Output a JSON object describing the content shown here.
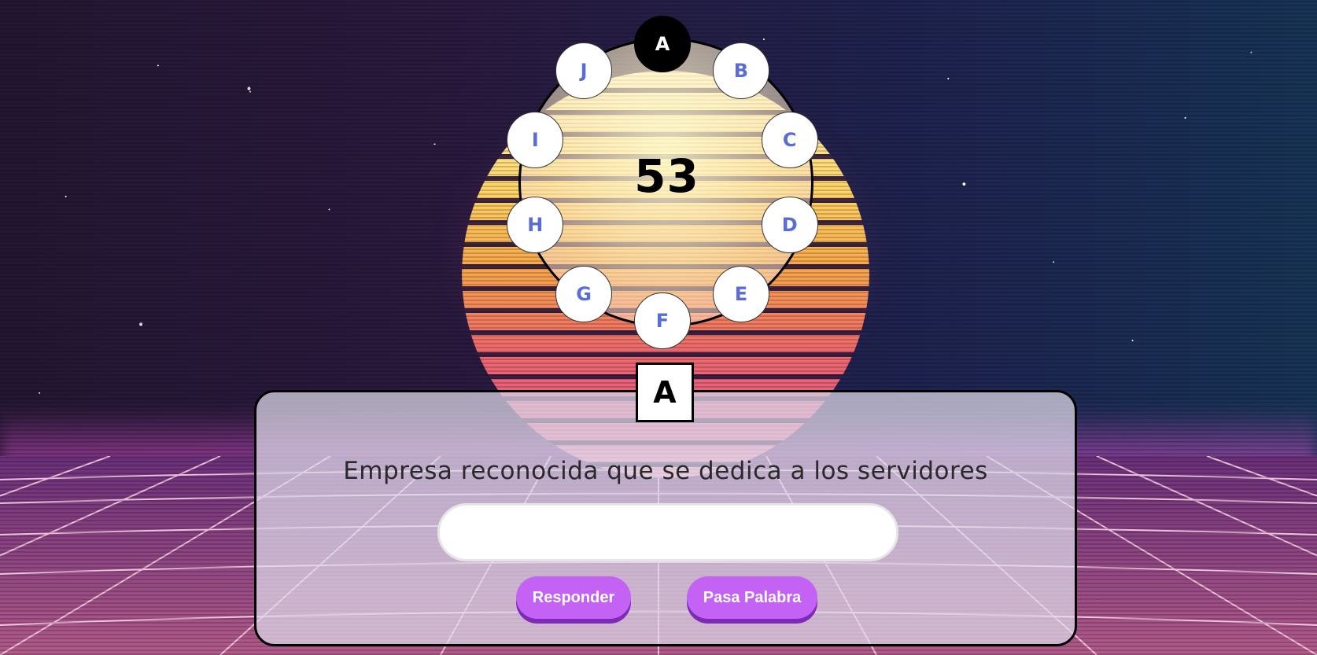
{
  "game": {
    "counter": "53",
    "current_letter": "A",
    "active_letter": "A"
  },
  "rosco": {
    "letters": [
      "A",
      "B",
      "C",
      "D",
      "E",
      "F",
      "G",
      "H",
      "I",
      "J"
    ]
  },
  "question": {
    "text": "Empresa reconocida que se dedica a los servidores"
  },
  "answer": {
    "value": "",
    "placeholder": ""
  },
  "buttons": {
    "respond_label": "Responder",
    "pass_label": "Pasa Palabra"
  },
  "colors": {
    "letter_text": "#5a6dd6",
    "button": "#c462f5",
    "button_shadow": "#7d2ab8"
  }
}
